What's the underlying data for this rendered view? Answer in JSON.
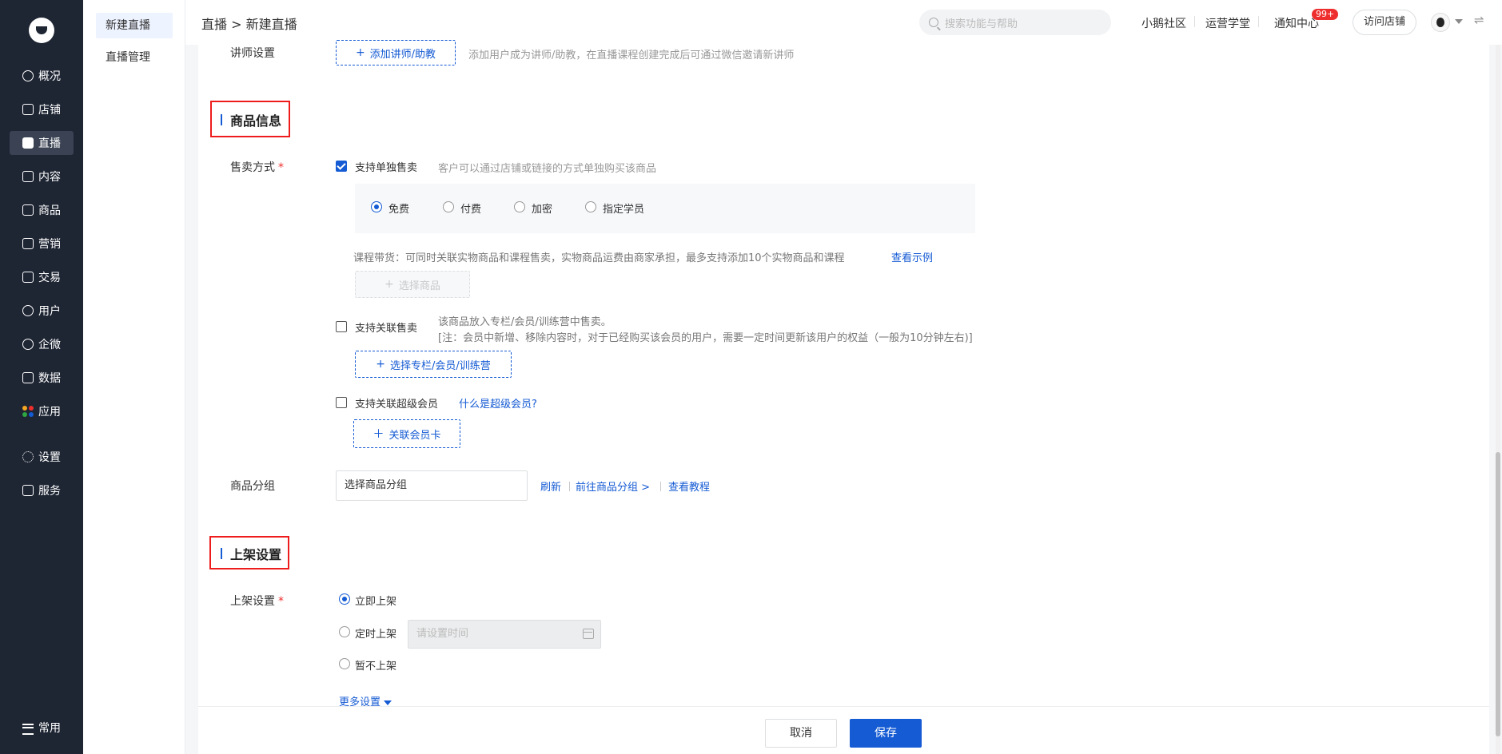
{
  "sidebar": {
    "items": [
      {
        "label": "概况",
        "icon": "dashboard-icon"
      },
      {
        "label": "店铺",
        "icon": "store-icon"
      },
      {
        "label": "直播",
        "icon": "live-icon"
      },
      {
        "label": "内容",
        "icon": "content-icon"
      },
      {
        "label": "商品",
        "icon": "goods-icon"
      },
      {
        "label": "营销",
        "icon": "marketing-icon"
      },
      {
        "label": "交易",
        "icon": "trade-icon"
      },
      {
        "label": "用户",
        "icon": "user-icon"
      },
      {
        "label": "企微",
        "icon": "wecom-icon"
      },
      {
        "label": "数据",
        "icon": "data-icon"
      },
      {
        "label": "应用",
        "icon": "apps-icon"
      },
      {
        "label": "设置",
        "icon": "gear-icon"
      },
      {
        "label": "服务",
        "icon": "service-icon"
      }
    ],
    "bottom": {
      "label": "常用",
      "icon": "list-icon"
    },
    "active": "直播",
    "app_colors": [
      "#f5a623",
      "#ee2e2e",
      "#2da641",
      "#155bd4"
    ]
  },
  "subnav": {
    "items": [
      "新建直播",
      "直播管理"
    ],
    "active": "新建直播"
  },
  "header": {
    "breadcrumb": "直播 > 新建直播",
    "search_placeholder": "搜索功能与帮助",
    "links": {
      "community": "小鹅社区",
      "school": "运营学堂",
      "notice": "通知中心",
      "notice_badge": "99+"
    },
    "visit_store": "访问店铺",
    "switch_icon": "⇌"
  },
  "lecturer": {
    "label": "讲师设置",
    "button": "添加讲师/助教",
    "hint": "添加用户成为讲师/助教，在直播课程创建完成后可通过微信邀请新讲师"
  },
  "goods_section": {
    "title": "商品信息",
    "sale_mode_label": "售卖方式",
    "required_mark": "*",
    "single_sale": {
      "label": "支持单独售卖",
      "checked": true,
      "hint": "客户可以通过店铺或链接的方式单独购买该商品"
    },
    "price_options": [
      "免费",
      "付费",
      "加密",
      "指定学员"
    ],
    "price_selected": "免费",
    "course_goods_hint": "课程带货：可同时关联实物商品和课程售卖，实物商品运费由商家承担，最多支持添加10个实物商品和课程",
    "view_example": "查看示例",
    "select_goods": "选择商品",
    "linked_sale": {
      "label": "支持关联售卖",
      "checked": false,
      "hint1": "该商品放入专栏/会员/训练营中售卖。",
      "hint2": "[注：会员中新增、移除内容时，对于已经购买该会员的用户，需要一定时间更新该用户的权益（一般为10分钟左右)]",
      "button": "选择专栏/会员/训练营"
    },
    "super_member": {
      "label": "支持关联超级会员",
      "checked": false,
      "what_is": "什么是超级会员?",
      "button": "关联会员卡"
    },
    "group_label": "商品分组",
    "group_value": "选择商品分组",
    "group_links": [
      "刷新",
      "前往商品分组 >",
      "查看教程"
    ]
  },
  "shelf_section": {
    "title": "上架设置",
    "label": "上架设置",
    "required_mark": "*",
    "options": [
      "立即上架",
      "定时上架",
      "暂不上架"
    ],
    "selected": "立即上架",
    "time_placeholder": "请设置时间",
    "more_settings": "更多设置"
  },
  "footer": {
    "cancel": "取消",
    "save": "保存"
  }
}
